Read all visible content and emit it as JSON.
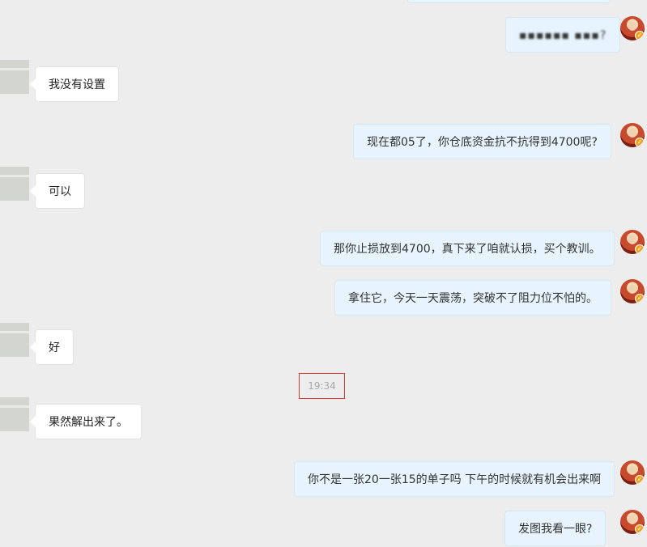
{
  "messages": [
    {
      "side": "right",
      "text": "▪▪▪▪▪▪ ▪▪▪?",
      "blurred": true
    },
    {
      "side": "left",
      "text": "我没有设置"
    },
    {
      "side": "right",
      "text": "现在都05了，你仓底资金抗不抗得到4700呢?"
    },
    {
      "side": "left",
      "text": "可以"
    },
    {
      "side": "right",
      "text": "那你止损放到4700，真下来了咱就认损，买个教训。"
    },
    {
      "side": "right",
      "text": "拿住它，今天一天震荡，突破不了阻力位不怕的。"
    },
    {
      "side": "left",
      "text": "好"
    },
    {
      "side": "left",
      "text": "果然解出来了。"
    },
    {
      "side": "right",
      "text": "你不是一张20一张15的单子吗 下午的时候就有机会出来啊"
    },
    {
      "side": "right",
      "text": "发图我看一眼?"
    }
  ],
  "timestamp": "19:34",
  "colors": {
    "background": "#ededed",
    "bubble_left": "#ffffff",
    "bubble_right": "#e8f4fd",
    "timestamp_border": "#d9392f"
  },
  "icons": {
    "left_avatar": "contact-avatar",
    "right_avatar": "user-avatar",
    "verified_badge": "verified-badge-icon"
  }
}
